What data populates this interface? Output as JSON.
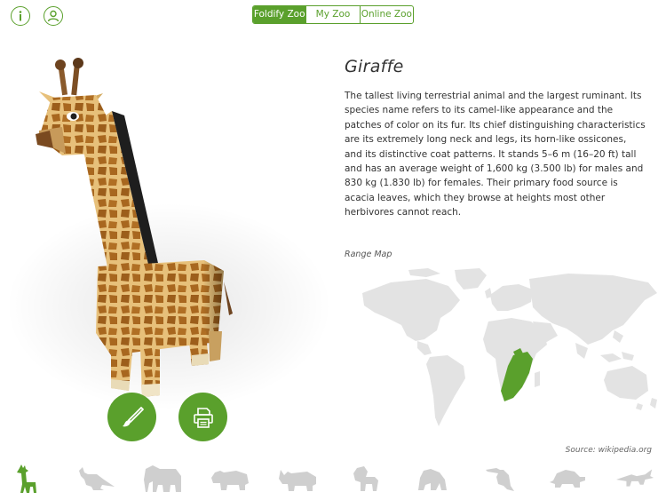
{
  "header": {
    "segments": [
      {
        "label": "Foldify Zoo",
        "active": true
      },
      {
        "label": "My Zoo",
        "active": false
      },
      {
        "label": "Online Zoo",
        "active": false
      }
    ],
    "info_icon": "info-icon",
    "user_icon": "user-icon"
  },
  "animal": {
    "name": "Giraffe",
    "description": "The tallest living terrestrial animal and the largest ruminant. Its species name refers to its camel-like appearance and the patches of color on its fur. Its chief distinguishing characteristics are its extremely long neck and legs, its horn-like ossicones, and its distinctive coat patterns. It stands 5–6 m (16–20 ft) tall and has an average weight of 1,600 kg (3.500 lb) for males and 830 kg (1.830 lb) for females. Their primary food source is acacia leaves, which they browse at heights most other herbivores cannot reach.",
    "range_label": "Range Map",
    "source": "Source: wikipedia.org"
  },
  "actions": {
    "paint_icon": "paintbrush-icon",
    "print_icon": "printer-icon"
  },
  "animal_bar": {
    "items": [
      "giraffe",
      "kangaroo",
      "elephant",
      "hippo",
      "rhino",
      "lion",
      "gorilla",
      "toucan",
      "turtle",
      "crocodile"
    ],
    "selected": "giraffe"
  },
  "colors": {
    "accent": "#5aa02c",
    "map_land": "#e3e3e3",
    "range_highlight": "#5aa02c",
    "inactive_icon": "#cfcfcf"
  }
}
